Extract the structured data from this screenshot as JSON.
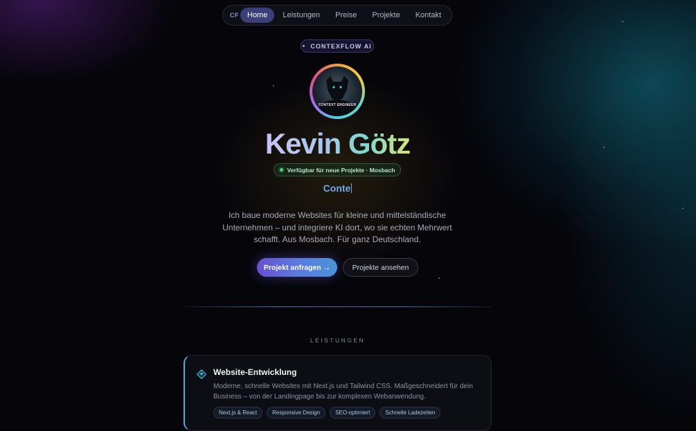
{
  "nav": {
    "logo": "CF",
    "items": [
      {
        "label": "Home",
        "active": true
      },
      {
        "label": "Leistungen",
        "active": false
      },
      {
        "label": "Preise",
        "active": false
      },
      {
        "label": "Projekte",
        "active": false
      },
      {
        "label": "Kontakt",
        "active": false
      }
    ]
  },
  "hero": {
    "badge": "CONTEXFLOW AI",
    "avatar_caption": "CONTEXT ENGINEER",
    "name": "Kevin Götz",
    "availability": "Verfügbar für neue Projekte · Mosbach",
    "typed_text": "Conte",
    "description": "Ich baue moderne Websites für kleine und mittelständische Unternehmen – und integriere KI dort, wo sie echten Mehrwert schafft. Aus Mosbach. Für ganz Deutschland.",
    "primary_button": "Projekt anfragen →",
    "secondary_button": "Projekte ansehen"
  },
  "services": {
    "section_label": "LEISTUNGEN",
    "cards": [
      {
        "icon": "diamond-icon",
        "title": "Website-Entwicklung",
        "text": "Moderne, schnelle Websites mit Next.js und Tailwind CSS. Maßgeschneidert für dein Business – von der Landingpage bis zur komplexen Webanwendung.",
        "tags": [
          "Next.js & React",
          "Responsive Design",
          "SEO-optimiert",
          "Schnelle Ladezeiten"
        ]
      }
    ]
  },
  "colors": {
    "accent_purple": "#6a4fd0",
    "accent_teal": "#3fc6e8",
    "available_green": "#4fcf7c",
    "background": "#05050a"
  }
}
